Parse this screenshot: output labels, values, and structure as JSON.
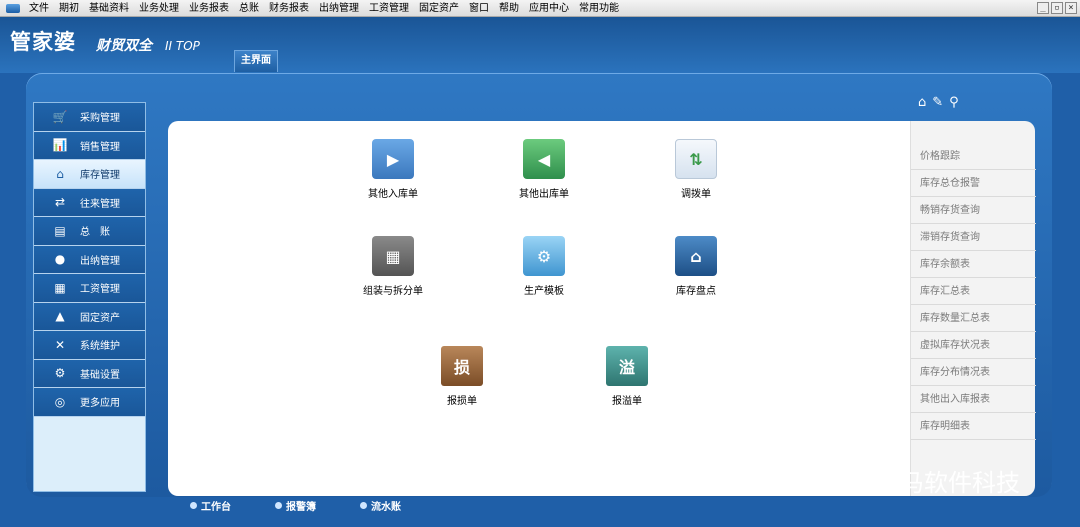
{
  "menubar": {
    "items": [
      "文件",
      "期初",
      "基础资料",
      "业务处理",
      "业务报表",
      "总账",
      "财务报表",
      "出纳管理",
      "工资管理",
      "固定资产",
      "窗口",
      "帮助",
      "应用中心",
      "常用功能"
    ],
    "window_buttons": [
      "_",
      "▫",
      "×"
    ]
  },
  "header": {
    "logo_main": "管家婆",
    "logo_sub": "财贸双全",
    "logo_ver": "II TOP",
    "main_tab": "主界面"
  },
  "toolbar_icons": [
    "home-icon",
    "tag-icon",
    "search-icon"
  ],
  "sidebar": {
    "items": [
      {
        "label": "采购管理",
        "icon": "cart-icon",
        "glyph": "🛒"
      },
      {
        "label": "销售管理",
        "icon": "chart-icon",
        "glyph": "📊"
      },
      {
        "label": "库存管理",
        "icon": "house-icon",
        "glyph": "⌂",
        "active": true
      },
      {
        "label": "往来管理",
        "icon": "exchange-icon",
        "glyph": "⇄"
      },
      {
        "label": "总　账",
        "icon": "ledger-icon",
        "glyph": "▤"
      },
      {
        "label": "出纳管理",
        "icon": "moneybag-icon",
        "glyph": "●"
      },
      {
        "label": "工资管理",
        "icon": "grid-icon",
        "glyph": "▦"
      },
      {
        "label": "固定资产",
        "icon": "assets-icon",
        "glyph": "▲"
      },
      {
        "label": "系统维护",
        "icon": "tools-icon",
        "glyph": "✕"
      },
      {
        "label": "基础设置",
        "icon": "gear-icon",
        "glyph": "⚙"
      },
      {
        "label": "更多应用",
        "icon": "target-icon",
        "glyph": "◎"
      }
    ]
  },
  "functions": [
    {
      "label": "其他入库单",
      "icon": "stock-in-icon",
      "color": "#4d8fd1",
      "glyph": "▶"
    },
    {
      "label": "其他出库单",
      "icon": "stock-out-icon",
      "color": "#3aa35a",
      "glyph": "◀"
    },
    {
      "label": "调拨单",
      "icon": "transfer-icon",
      "color": "#e8eef5",
      "glyph": "⇅"
    },
    {
      "label": "组装与拆分单",
      "icon": "assembly-icon",
      "color": "#6a6a6a",
      "glyph": "▦"
    },
    {
      "label": "生产模板",
      "icon": "production-gear-icon",
      "color": "#5aaee0",
      "glyph": "⚙"
    },
    {
      "label": "库存盘点",
      "icon": "inventory-house-icon",
      "color": "#2b6aa6",
      "glyph": "⌂"
    },
    {
      "label": "报损单",
      "icon": "loss-book-icon",
      "color": "#9a6a3c",
      "glyph": "损"
    },
    {
      "label": "报溢单",
      "icon": "overflow-book-icon",
      "color": "#3e8f8a",
      "glyph": "溢"
    }
  ],
  "right_panel": {
    "items": [
      "价格跟踪",
      "库存总仓报警",
      "畅销存货查询",
      "滞销存货查询",
      "库存余额表",
      "库存汇总表",
      "库存数量汇总表",
      "虚拟库存状况表",
      "库存分布情况表",
      "其他出入库报表",
      "库存明细表"
    ]
  },
  "bottom_tabs": [
    "工作台",
    "报警簿",
    "流水账"
  ],
  "watermark": "昆明逸马软件科技"
}
